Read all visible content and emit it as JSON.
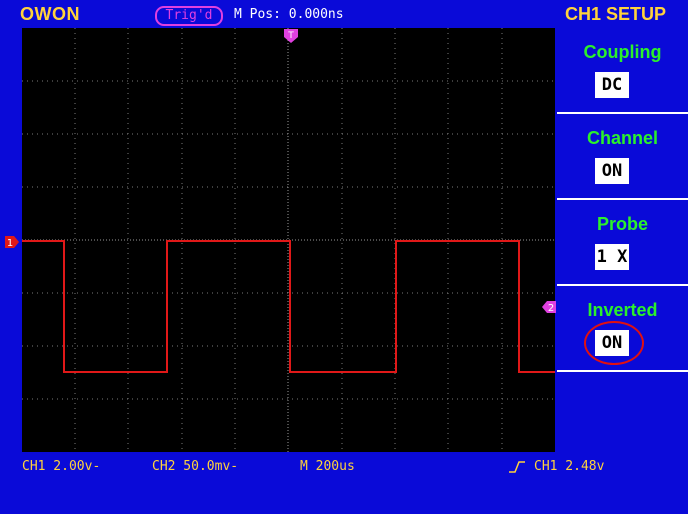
{
  "header": {
    "brand": "OWON",
    "trigger_status": "Trig'd",
    "m_pos": "M Pos: 0.000ns",
    "menu_title": "CH1 SETUP"
  },
  "menu": {
    "items": [
      {
        "label": "Coupling",
        "value": "DC"
      },
      {
        "label": "Channel",
        "value": "ON"
      },
      {
        "label": "Probe",
        "value": "1 X"
      },
      {
        "label": "Inverted",
        "value": "ON"
      }
    ]
  },
  "footer": {
    "ch1_scale": "CH1 2.00v-",
    "ch2_scale": "CH2 50.0mv-",
    "timebase": "M 200us",
    "trigger": "CH1 2.48v"
  },
  "markers": {
    "trigger_top": "T",
    "ch1": "1",
    "ch2": "2"
  },
  "colors": {
    "background": "#0a0ad8",
    "trace": "#e01818",
    "label_yellow": "#ffd23c",
    "menu_green": "#2bf02b",
    "trigger_magenta": "#e040e0"
  }
}
